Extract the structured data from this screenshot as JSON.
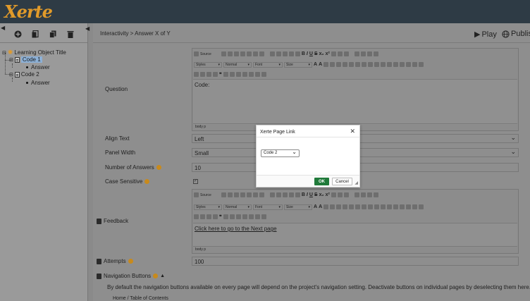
{
  "app": {
    "logo_text": "Xerte",
    "brand_color": "#e09a2a",
    "header_color": "#2e3b45"
  },
  "left_panel": {
    "toolbar": [
      {
        "icon": "add-icon"
      },
      {
        "icon": "import-icon"
      },
      {
        "icon": "duplicate-icon"
      },
      {
        "icon": "delete-icon"
      }
    ],
    "tree": {
      "root": "Learning Object Title",
      "pages": [
        {
          "label": "Code 1",
          "selected": true,
          "child": "Answer"
        },
        {
          "label": "Code 2",
          "selected": false,
          "child": "Answer"
        }
      ]
    }
  },
  "main": {
    "breadcrumb": "Interactivity > Answer X of Y",
    "play_label": "Play",
    "publish_label": "Publis",
    "editor": {
      "source_label": "Source",
      "styles_label": "Styles",
      "format_label": "Normal",
      "font_label": "Font",
      "size_label": "Size",
      "status": "body  p"
    },
    "question": {
      "label": "Question",
      "value": "Code:"
    },
    "align_text": {
      "label": "Align Text",
      "value": "Left"
    },
    "panel_width": {
      "label": "Panel Width",
      "value": "Small"
    },
    "num_answers": {
      "label": "Number of Answers",
      "value": "10"
    },
    "case_sensitive": {
      "label": "Case Sensitive",
      "checked": true
    },
    "feedback": {
      "label": "Feedback",
      "value": "Click here to go to the Next page"
    },
    "attempts": {
      "label": "Attempts",
      "value": "100"
    },
    "nav_buttons": {
      "label": "Navigation Buttons",
      "description": "By default the navigation buttons available on every page will depend on the project's navigation setting. Deactivate buttons on individual pages by deselecting them here.",
      "partial_next": "Home / Table of Contents"
    }
  },
  "dialog": {
    "title": "Xerte Page Link",
    "selected_page": "Code 2",
    "ok_label": "OK",
    "cancel_label": "Cancel",
    "ok_color": "#207a3a"
  }
}
